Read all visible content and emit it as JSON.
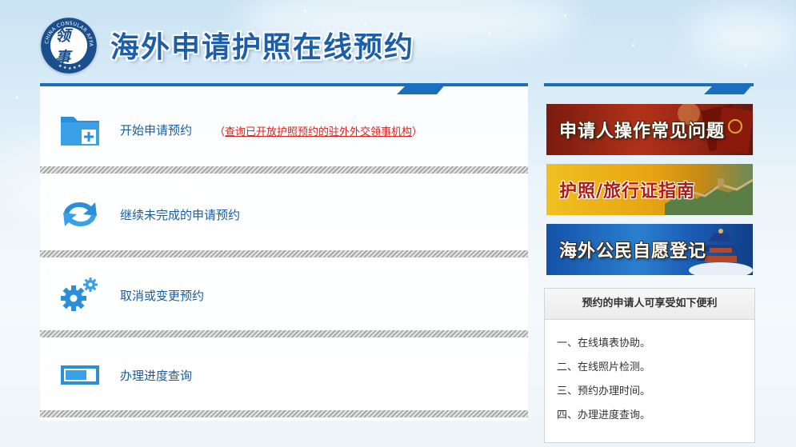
{
  "header": {
    "title": "海外申请护照在线预约",
    "emblem": {
      "ring_text": "CHINA CONSULAR AFFAIRS",
      "core_text": "领事"
    }
  },
  "menu": [
    {
      "label": "开始申请预约",
      "icon": "folder-add-icon",
      "note_open": "（",
      "note_link": "查询已开放护照预约的驻外外交领事机构",
      "note_close": "）"
    },
    {
      "label": "继续未完成的申请预约",
      "icon": "refresh-arrows-icon"
    },
    {
      "label": "取消或变更预约",
      "icon": "gears-icon"
    },
    {
      "label": "办理进度查询",
      "icon": "progress-bar-icon"
    }
  ],
  "sidebar": {
    "banners": [
      {
        "text": "申请人操作常见问题",
        "theme": "passport-red"
      },
      {
        "text": "护照/旅行证指南",
        "theme": "great-wall-gold"
      },
      {
        "text": "海外公民自愿登记",
        "theme": "temple-blue"
      }
    ],
    "benefits": {
      "title": "预约的申请人可享受如下便利",
      "items": [
        "一、在线填表协助。",
        "二、在线照片检测。",
        "三、预约办理时间。",
        "四、办理进度查询。"
      ]
    }
  },
  "colors": {
    "accent_blue": "#1a6fbf",
    "link_red": "#e0211b",
    "label_blue": "#1a5c9e"
  }
}
